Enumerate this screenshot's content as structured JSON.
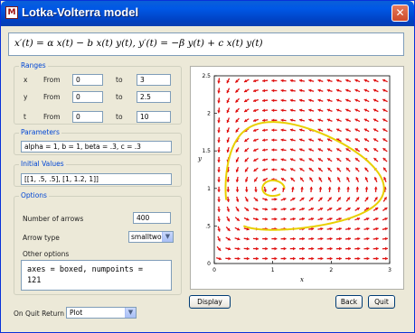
{
  "window": {
    "title": "Lotka-Volterra model",
    "close_glyph": "✕",
    "app_icon_glyph": "M"
  },
  "formula": "x′(t) = α x(t) − b x(t) y(t),  y′(t) = −β y(t) + c x(t) y(t)",
  "ranges": {
    "title": "Ranges",
    "from_label": "From",
    "to_label": "to",
    "rows": [
      {
        "var": "x",
        "from": "0",
        "to": "3"
      },
      {
        "var": "y",
        "from": "0",
        "to": "2.5"
      },
      {
        "var": "t",
        "from": "0",
        "to": "10"
      }
    ]
  },
  "parameters": {
    "title": "Parameters",
    "value": "alpha = 1, b = 1, beta = .3, c = .3"
  },
  "initial_values": {
    "title": "Initial Values",
    "value": "[[1, .5, .5], [1, 1.2, 1]]"
  },
  "options": {
    "title": "Options",
    "num_arrows_label": "Number of arrows",
    "num_arrows_value": "400",
    "arrow_type_label": "Arrow type",
    "arrow_type_value": "smalltwo",
    "other_options_label": "Other options",
    "other_options_value": "axes = boxed, numpoints =\n121"
  },
  "on_quit": {
    "label": "On Quit Return",
    "value": "Plot"
  },
  "buttons": {
    "display": "Display",
    "back": "Back",
    "quit": "Quit"
  },
  "plot": {
    "y_axis_label": "y",
    "x_axis_label": "x",
    "x_ticks": [
      "0",
      "1",
      "2",
      "3"
    ],
    "y_ticks": [
      "0",
      ".5",
      "1",
      "1.5",
      "2",
      "2.5"
    ],
    "arrow_color": "#e01010",
    "orbit_color": "#e8d000"
  }
}
